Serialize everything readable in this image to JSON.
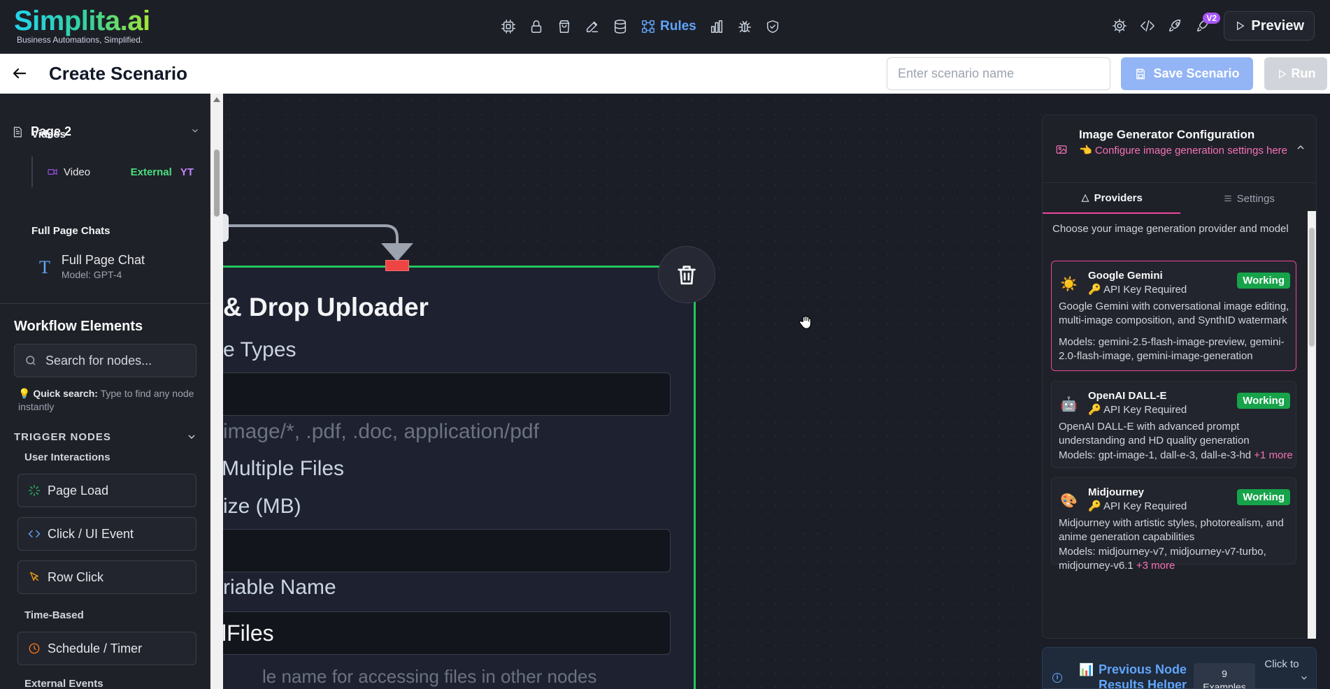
{
  "app": {
    "logo": "Simplita.ai",
    "tagline": "Business Automations, Simplified.",
    "rules_label": "Rules",
    "version_badge": "V2",
    "preview_label": "Preview"
  },
  "subheader": {
    "title": "Create Scenario",
    "scenario_placeholder": "Enter scenario name",
    "save_label": "Save Scenario",
    "run_label": "Run"
  },
  "sidebar": {
    "page_label": "Page 2",
    "videos_label": "Videos",
    "video_item": {
      "label": "Video",
      "source": "External",
      "type": "YT"
    },
    "chats_label": "Full Page Chats",
    "chat_item": {
      "title": "Full Page Chat",
      "subtitle": "Model: GPT-4"
    },
    "workflow_title": "Workflow Elements",
    "search_placeholder": "Search for nodes...",
    "tip_bold": "Quick search:",
    "tip_text": " Type to find any node instantly",
    "trigger_header": "TRIGGER NODES",
    "groups": {
      "user_interactions": "User Interactions",
      "time_based": "Time-Based",
      "external_events": "External Events"
    },
    "nodes": {
      "page_load": "Page Load",
      "click_event": "Click / UI Event",
      "row_click": "Row Click",
      "schedule": "Schedule / Timer"
    }
  },
  "canvas": {
    "node_title": "& Drop Uploader",
    "file_types_label": "e Types",
    "file_types_hint": "image/*, .pdf, .doc, application/pdf",
    "multiple_label": "Multiple Files",
    "size_label": "ize (MB)",
    "variable_label": "riable Name",
    "variable_value": "lFiles",
    "footer_hint": "le name for accessing files in other nodes"
  },
  "config": {
    "title": "Image Generator Configuration",
    "subtitle": "👈 Configure image generation settings here",
    "tabs": {
      "providers": "Providers",
      "settings": "Settings"
    },
    "intro": "Choose your image generation provider and model",
    "providers": [
      {
        "icon": "☀️",
        "name": "Google Gemini",
        "key": "🔑 API Key Required",
        "status": "Working",
        "desc": "Google Gemini with conversational image editing, multi-image composition, and SynthID watermark",
        "models": "Models: gemini-2.5-flash-image-preview, gemini-2.0-flash-image, gemini-image-generation",
        "more": ""
      },
      {
        "icon": "🤖",
        "name": "OpenAI DALL-E",
        "key": "🔑 API Key Required",
        "status": "Working",
        "desc": "OpenAI DALL-E with advanced prompt understanding and HD quality generation",
        "models": "Models: gpt-image-1, dall-e-3, dall-e-3-hd ",
        "more": "+1 more"
      },
      {
        "icon": "🎨",
        "name": "Midjourney",
        "key": "🔑 API Key Required",
        "status": "Working",
        "desc": "Midjourney with artistic styles, photorealism, and anime generation capabilities",
        "models": "Models: midjourney-v7, midjourney-v7-turbo, midjourney-v6.1 ",
        "more": "+3 more"
      }
    ]
  },
  "helper": {
    "icon": "📊",
    "title": "Previous Node Results Helper",
    "count": "9",
    "count_label": "Examples",
    "click_label": "Click to"
  }
}
